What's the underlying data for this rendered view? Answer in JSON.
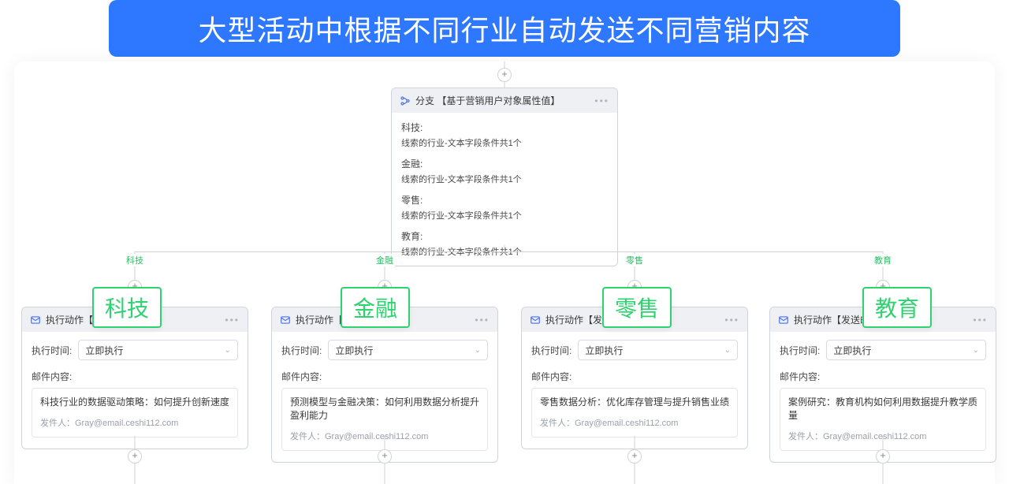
{
  "title": "大型活动中根据不同行业自动发送不同营销内容",
  "branch": {
    "header": "分支 【基于营销用户对象属性值】",
    "conditions": [
      {
        "label": "科技:",
        "desc": "线索的行业-文本字段条件共1个"
      },
      {
        "label": "金融:",
        "desc": "线索的行业-文本字段条件共1个"
      },
      {
        "label": "零售:",
        "desc": "线索的行业-文本字段条件共1个"
      },
      {
        "label": "教育:",
        "desc": "线索的行业-文本字段条件共1个"
      }
    ]
  },
  "fanout_labels": [
    "科技",
    "金融",
    "零售",
    "教育"
  ],
  "big_badges": [
    "科技",
    "金融",
    "零售",
    "教育"
  ],
  "fields": {
    "exec_time_label": "执行时间:",
    "content_label": "邮件内容:",
    "sender_prefix": "发件人："
  },
  "cards": [
    {
      "header": "执行动作【发",
      "exec_value": "立即执行",
      "subject": "科技行业的数据驱动策略：如何提升创新速度",
      "sender": "Gray@email.ceshi112.com"
    },
    {
      "header": "执行动作【发送",
      "exec_value": "立即执行",
      "subject": "预测模型与金融决策：如何利用数据分析提升盈利能力",
      "sender": "Gray@email.ceshi112.com"
    },
    {
      "header": "执行动作【发送",
      "exec_value": "立即执行",
      "subject": "零售数据分析：优化库存管理与提升销售业绩",
      "sender": "Gray@email.ceshi112.com"
    },
    {
      "header": "执行动作【发送邮件",
      "exec_value": "立即执行",
      "subject": "案例研究：教育机构如何利用数据提升教学质量",
      "sender": "Gray@email.ceshi112.com"
    }
  ]
}
